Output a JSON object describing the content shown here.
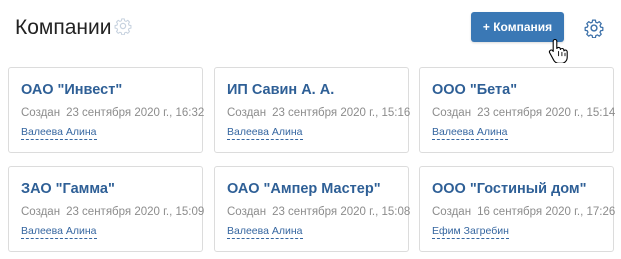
{
  "header": {
    "title": "Компании",
    "add_button_label": "+ Компания",
    "title_icon": "gear-icon",
    "settings_icon": "gear-icon",
    "cursor_icon": "hand-pointer-icon"
  },
  "colors": {
    "accent": "#3a78b5",
    "link": "#2e5f96",
    "muted_text": "#8c8c8c",
    "card_border": "#dcdcdc",
    "icon": "#8aa8c8"
  },
  "cards": [
    {
      "name": "ОАО \"Инвест\"",
      "created_label": "Создан",
      "created_date": "23 сентября 2020 г., 16:32",
      "author": "Валеева Алина"
    },
    {
      "name": "ИП Савин А. А.",
      "created_label": "Создан",
      "created_date": "23 сентября 2020 г., 15:16",
      "author": "Валеева Алина"
    },
    {
      "name": "ООО \"Бета\"",
      "created_label": "Создан",
      "created_date": "23 сентября 2020 г., 15:14",
      "author": "Валеева Алина"
    },
    {
      "name": "ЗАО \"Гамма\"",
      "created_label": "Создан",
      "created_date": "23 сентября 2020 г., 15:09",
      "author": "Валеева Алина"
    },
    {
      "name": "ОАО \"Ампер Мастер\"",
      "created_label": "Создан",
      "created_date": "23 сентября 2020 г., 15:08",
      "author": "Валеева Алина"
    },
    {
      "name": "ООО \"Гостиный дом\"",
      "created_label": "Создан",
      "created_date": "16 сентября 2020 г., 17:26",
      "author": "Ефим Загребин"
    }
  ]
}
